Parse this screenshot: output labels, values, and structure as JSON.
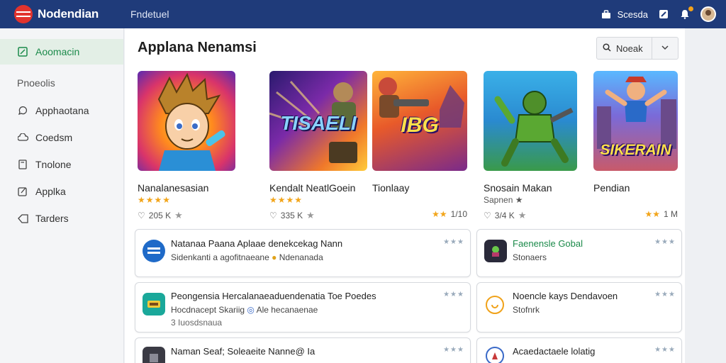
{
  "header": {
    "brand": "Nodendian",
    "nav_label": "Fndetuel",
    "search_label": "Scesda",
    "icons": [
      "briefcase-icon",
      "search-icon",
      "bell-icon",
      "avatar"
    ]
  },
  "sidebar": {
    "active_item": "Aoomacin",
    "section_label": "Pnoeolis",
    "items": [
      "Apphaotana",
      "Coedsm",
      "Tnolone",
      "Applka",
      "Tarders"
    ]
  },
  "main": {
    "title": "Applana Nenamsi",
    "sort_label": "Noeak"
  },
  "games": [
    {
      "name": "Nanalanesasian",
      "stars": "★★★★",
      "sub": "",
      "meta": "205 K",
      "thumb_text": ""
    },
    {
      "name": "Kendalt NeatlGoein",
      "stars": "★★★★",
      "sub": "",
      "meta": "335 K",
      "thumb_text": "TISAELI"
    },
    {
      "name": "Tionlaay",
      "stars": "",
      "sub": "",
      "meta": "1/10",
      "thumb_text": "IBG"
    },
    {
      "name": "Snosain Makan",
      "stars": "",
      "sub": "Sapnen ★",
      "meta": "3/4 K",
      "thumb_text": ""
    },
    {
      "name": "Pendian",
      "stars": "",
      "sub": "",
      "meta": "1 M",
      "thumb_text": "SIKERAIN"
    }
  ],
  "list": [
    {
      "title": "Natanaa Paana Aplaae denekcekag Nann",
      "line1": "Sidenkanti a agofitnaeane",
      "line1b": "Ndenanada",
      "line2": ""
    },
    {
      "title": "Faenensle Gobal",
      "line1": "Stonaers",
      "line1b": "",
      "line2": ""
    },
    {
      "title": "Peongensia Hercalanaeaduendenatia Toe Poedes",
      "line1": "Hocdnacept Skariig",
      "line1b": "Ale hecanaenae",
      "line2": "3 Iuosdsnaua"
    },
    {
      "title": "Noencle kays Dendavoen",
      "line1": "Stofnrk",
      "line1b": "",
      "line2": ""
    },
    {
      "title": "Naman Seaf; Soleaeite Nanne@ Ia",
      "line1": "",
      "line1b": "",
      "line2": ""
    },
    {
      "title": "Acaedactaele lolatig",
      "line1": "",
      "line1b": "",
      "line2": ""
    }
  ],
  "colors": {
    "header_bg": "#1f3b7a",
    "accent_green": "#1b8a4a",
    "brand_red": "#e2332d",
    "star_gold": "#f2a51a"
  }
}
